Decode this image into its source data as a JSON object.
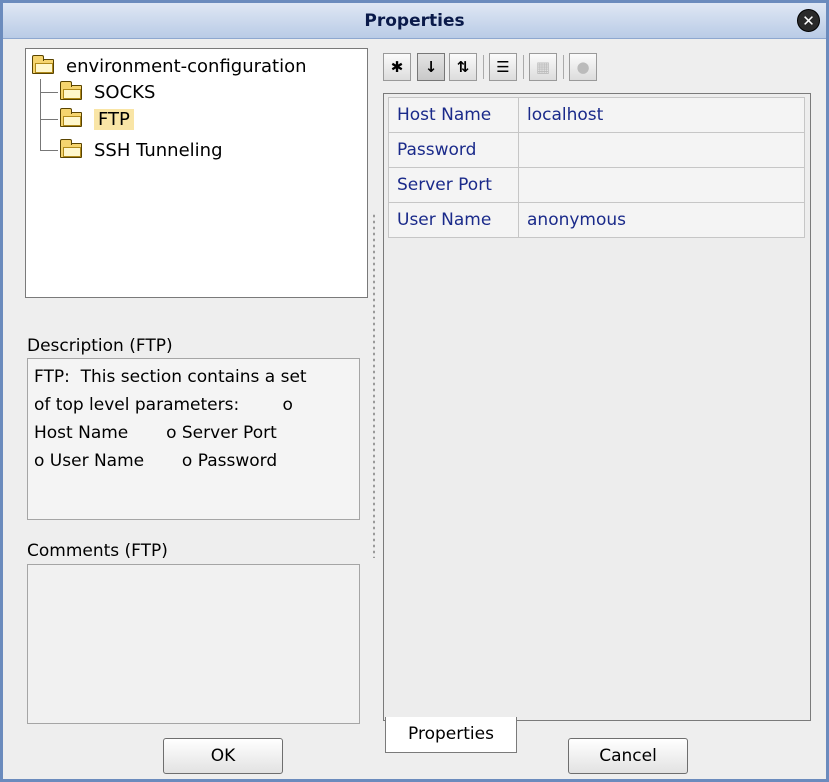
{
  "window": {
    "title": "Properties",
    "close_icon": "close-icon"
  },
  "tree": {
    "root": "environment-configuration",
    "children": [
      "SOCKS",
      "FTP",
      "SSH Tunneling"
    ],
    "selected": "FTP"
  },
  "description": {
    "label": "Description (FTP)",
    "text": "FTP:  This section contains a set\nof top level parameters:        o\nHost Name       o Server Port\no User Name       o Password"
  },
  "comments": {
    "label": "Comments (FTP)",
    "text": ""
  },
  "toolbar": {
    "icons": [
      "categorized-icon",
      "sort-alpha-icon",
      "sort-category-icon",
      "show-expert-icon",
      "grid-icon",
      "help-icon"
    ]
  },
  "properties": [
    {
      "name": "Host Name",
      "value": "localhost"
    },
    {
      "name": "Password",
      "value": ""
    },
    {
      "name": "Server Port",
      "value": ""
    },
    {
      "name": "User Name",
      "value": "anonymous"
    }
  ],
  "tab": {
    "label": "Properties"
  },
  "buttons": {
    "ok": "OK",
    "cancel": "Cancel"
  },
  "colors": {
    "title_bg": "#b9cbe6",
    "selection": "#f9e5a6",
    "property_text": "#1a2a8a"
  }
}
